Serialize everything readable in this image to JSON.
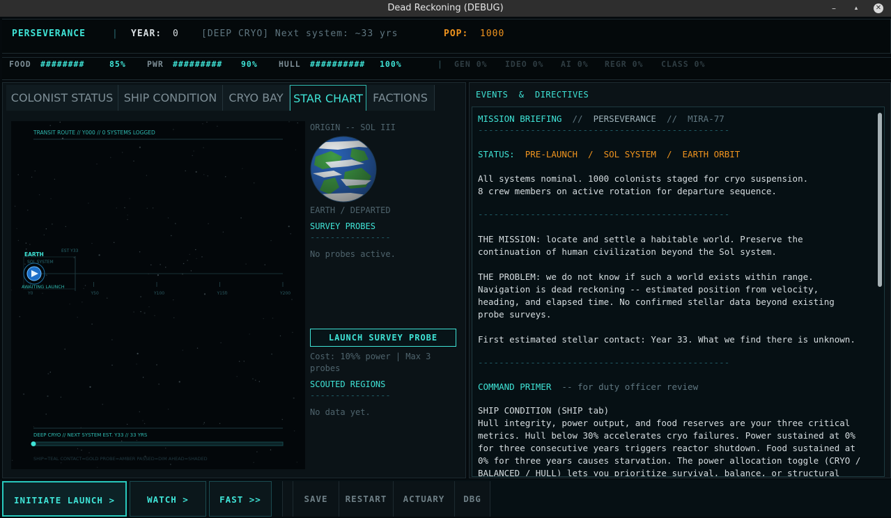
{
  "window": {
    "title": "Dead Reckoning (DEBUG)",
    "minimize": "–",
    "restore": "▴",
    "close": "✕"
  },
  "hud": {
    "ship": "PERSEVERANCE",
    "divider": "|",
    "year_label": "YEAR:",
    "year_value": "0",
    "status": "[DEEP CRYO] Next system: ~33 yrs",
    "pop_label": "POP:",
    "pop_value": "1000"
  },
  "stats": {
    "food": {
      "label": "FOOD",
      "bar": "########",
      "value": "85%"
    },
    "pwr": {
      "label": "PWR",
      "bar": "#########",
      "value": "90%"
    },
    "hull": {
      "label": "HULL",
      "bar": "##########",
      "value": "100%"
    },
    "divider": "|",
    "gen": "GEN 0%",
    "ideo": "IDEO 0%",
    "ai": "AI 0%",
    "regr": "REGR 0%",
    "class": "CLASS 0%"
  },
  "tabs": [
    "COLONIST STATUS",
    "SHIP CONDITION",
    "CRYO BAY",
    "STAR CHART",
    "FACTIONS"
  ],
  "active_tab": "STAR CHART",
  "chart": {
    "header": "TRANSIT ROUTE  //  Y000  //  0 SYSTEMS LOGGED",
    "origin_label": "EARTH",
    "origin_sub": "SOL SYSTEM",
    "origin_state": "AWAITING LAUNCH",
    "est_marker": "EST Y33",
    "axis_ticks": [
      "Y0",
      "Y50",
      "Y100",
      "Y150",
      "Y200"
    ],
    "footer": "DEEP CRYO  //  NEXT SYSTEM EST. Y33  //  33 YRS",
    "legend": "SHIP=TEAL  CONTACT=GOLD  PROBE=AMBER  PASSED=DIM  AHEAD=SHADED",
    "progress": 0.0
  },
  "side": {
    "origin_title": "ORIGIN -- SOL III",
    "planet_caption": "EARTH / DEPARTED",
    "probes_title": "SURVEY PROBES",
    "rule": "----------------",
    "probes_status": "No probes active.",
    "launch_button": "LAUNCH SURVEY PROBE",
    "cost_line1": "Cost: 10%% power | Max 3",
    "cost_line2": "probes",
    "scouted_title": "SCOUTED REGIONS",
    "scouted_status": "No data yet."
  },
  "events": {
    "title": "EVENTS  &  DIRECTIVES",
    "briefing_a": "MISSION BRIEFING",
    "briefing_sep1": "//",
    "briefing_b": "PERSEVERANCE",
    "briefing_sep2": "//",
    "briefing_c": "MIRA-77",
    "divider": "------------------------------------------------",
    "status_label": "STATUS:",
    "status_value": "PRE-LAUNCH  /  SOL SYSTEM  /  EARTH ORBIT",
    "line1": "All systems nominal. 1000 colonists staged for cryo suspension.",
    "line2": "8 crew members on active rotation for departure sequence.",
    "divider2": "------------------------------------------------",
    "mission1": "THE MISSION: locate and settle a habitable world. Preserve the",
    "mission2": "continuation of human civilization beyond the Sol system.",
    "problem1": "THE PROBLEM: we do not know if such a world exists within range.",
    "problem2": "Navigation is dead reckoning -- estimated position from velocity,",
    "problem3": "heading, and elapsed time. No confirmed stellar data beyond existing",
    "problem4": "probe surveys.",
    "contact": "First estimated stellar contact: Year 33. What we find there is unknown.",
    "divider3": "------------------------------------------------",
    "primer_title": "COMMAND PRIMER",
    "primer_note": "-- for duty officer review",
    "ship_cond_title": "SHIP CONDITION (SHIP tab)",
    "sc1": "Hull integrity, power output, and food reserves are your three critical",
    "sc2": "metrics. Hull below 30% accelerates cryo failures. Power sustained at 0%",
    "sc3": "for three consecutive years triggers reactor shutdown. Food sustained at",
    "sc4": "0% for three years causes starvation. The power allocation toggle (CRYO /",
    "sc5": "BALANCED / HULL) lets you prioritize survival, balance, or structural"
  },
  "controls": {
    "initiate": "INITIATE LAUNCH >",
    "watch": "WATCH >",
    "fast": "FAST >>",
    "save": "SAVE",
    "restart": "RESTART",
    "actuary": "ACTUARY",
    "dbg": "DBG"
  },
  "colors": {
    "teal": "#3fe3d6",
    "amber": "#f0941e",
    "panel": "#0b1317"
  }
}
